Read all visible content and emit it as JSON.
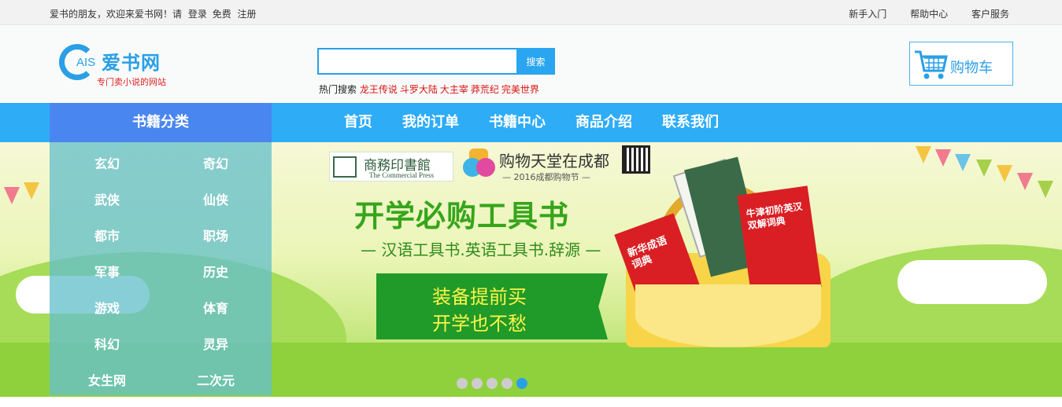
{
  "topbar": {
    "welcome_text": "爱书的朋友，欢迎来爱书网！请",
    "login": "登录",
    "free": "免费",
    "register": "注册",
    "links": [
      "新手入门",
      "帮助中心",
      "客户服务"
    ]
  },
  "logo": {
    "prefix": "AIS",
    "name": "爱书网",
    "slogan": "专门卖小说的网站"
  },
  "search": {
    "value": "",
    "button": "搜索",
    "hot_label": "热门搜索",
    "hot_keywords": [
      "龙王传说",
      "斗罗大陆",
      "大主宰",
      "莽荒纪",
      "完美世界"
    ]
  },
  "cart": {
    "label": "购物车"
  },
  "nav": {
    "category_title": "书籍分类",
    "links": [
      "首页",
      "我的订单",
      "书籍中心",
      "商品介绍",
      "联系我们"
    ]
  },
  "categories": [
    "玄幻",
    "奇幻",
    "武侠",
    "仙侠",
    "都市",
    "职场",
    "军事",
    "历史",
    "游戏",
    "体育",
    "科幻",
    "灵异",
    "女生网",
    "二次元"
  ],
  "banner": {
    "publisher_cn": "商務印書館",
    "publisher_en": "The Commercial Press",
    "event_title": "购物天堂在成都",
    "event_sub": "— 2016成都购物节 —",
    "headline": "开学必购工具书",
    "subline": "— 汉语工具书.英语工具书.辞源 —",
    "promo_line1": "装备提前买",
    "promo_line2": "开学也不愁",
    "book1": "新华成语词典",
    "book2": "牛津初阶英汉双解词典",
    "slide_count": 5,
    "active_slide": 5
  },
  "colors": {
    "brand_blue": "#2a9fe6",
    "nav_blue": "#2eacf6",
    "category_blue": "#4a86f0",
    "hot_red": "#d8120d",
    "headline_green": "#36a51b"
  }
}
